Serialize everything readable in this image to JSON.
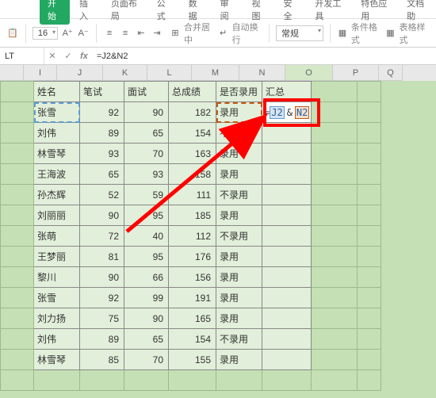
{
  "tabs": {
    "start": "开始",
    "insert": "插入",
    "layout": "页面布局",
    "formula": "公式",
    "data": "数据",
    "review": "审阅",
    "view": "视图",
    "security": "安全",
    "dev": "开发工具",
    "special": "特色应用",
    "docassist": "文档助"
  },
  "toolbar": {
    "font_size": "16",
    "merge": "合并居中",
    "wrap": "自动换行",
    "numfmt": "常规",
    "condfmt": "条件格式",
    "cellstyle": "表格样式"
  },
  "formula_bar": {
    "name_box": "LT",
    "formula": "=J2&N2"
  },
  "columns": [
    "I",
    "J",
    "K",
    "L",
    "M",
    "N",
    "O",
    "P",
    "Q"
  ],
  "headers": {
    "name": "姓名",
    "written": "笔试",
    "interview": "面试",
    "total": "总成绩",
    "hire": "是否录用",
    "summary": "汇总"
  },
  "editing_cell": {
    "eq": "=",
    "ref1": "J2",
    "amp": "&",
    "ref2": "N2"
  },
  "rows": [
    {
      "name": "张雪",
      "written": 92,
      "interview": 90,
      "total": 182,
      "hire": "录用"
    },
    {
      "name": "刘伟",
      "written": 89,
      "interview": 65,
      "total": 154,
      "hire": "不录用"
    },
    {
      "name": "林雪琴",
      "written": 93,
      "interview": 70,
      "total": 163,
      "hire": "录用"
    },
    {
      "name": "王海波",
      "written": 65,
      "interview": 93,
      "total": 158,
      "hire": "录用"
    },
    {
      "name": "孙杰辉",
      "written": 52,
      "interview": 59,
      "total": 111,
      "hire": "不录用"
    },
    {
      "name": "刘丽丽",
      "written": 90,
      "interview": 95,
      "total": 185,
      "hire": "录用"
    },
    {
      "name": "张萌",
      "written": 72,
      "interview": 40,
      "total": 112,
      "hire": "不录用"
    },
    {
      "name": "王梦丽",
      "written": 81,
      "interview": 95,
      "total": 176,
      "hire": "录用"
    },
    {
      "name": "黎川",
      "written": 90,
      "interview": 66,
      "total": 156,
      "hire": "录用"
    },
    {
      "name": "张雪",
      "written": 92,
      "interview": 99,
      "total": 191,
      "hire": "录用"
    },
    {
      "name": "刘力扬",
      "written": 75,
      "interview": 90,
      "total": 165,
      "hire": "录用"
    },
    {
      "name": "刘伟",
      "written": 89,
      "interview": 65,
      "total": 154,
      "hire": "不录用"
    },
    {
      "name": "林雪琴",
      "written": 85,
      "interview": 70,
      "total": 155,
      "hire": "录用"
    }
  ]
}
